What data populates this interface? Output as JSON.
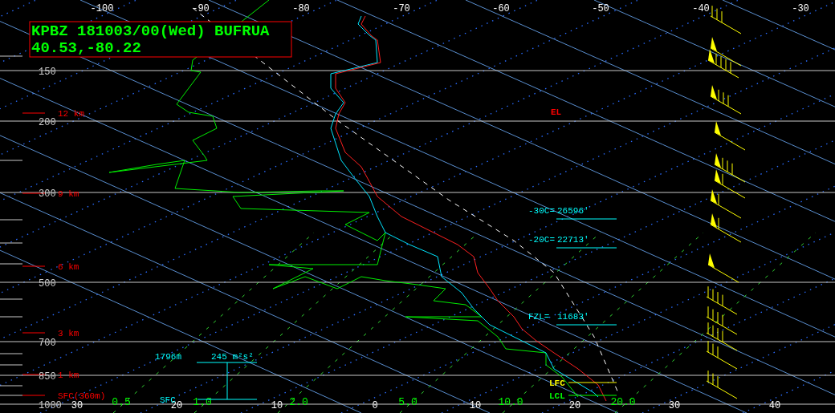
{
  "title_box": {
    "station_line": "KPBZ 181003/00(Wed) BUFRUA",
    "coordinates": "40.53,-80.22"
  },
  "top_temperature_labels": [
    "-100",
    "-90",
    "-80",
    "-70",
    "-60",
    "-50",
    "-40",
    "-30"
  ],
  "bottom_temperature_labels": [
    "30",
    "20",
    "10",
    "0",
    "10",
    "20",
    "30",
    "40"
  ],
  "pressure_labels": [
    "150",
    "200",
    "300",
    "500",
    "700",
    "850",
    "1000"
  ],
  "height_labels": [
    "12 km",
    "9 km",
    "6 km",
    "3 km",
    "1 km",
    "SFC(360m)"
  ],
  "mixing_ratio_labels": [
    "0.5",
    "1.0",
    "2.0",
    "5.0",
    "10.0",
    "20.0"
  ],
  "helicity": {
    "top_height": "1796m",
    "value": "245 m²s²",
    "base": "SFC"
  },
  "temperature_levels": [
    {
      "label": "-30C=",
      "height": "26596'"
    },
    {
      "label": "-20C=",
      "height": "22713'"
    },
    {
      "label": "FZL=",
      "height": "11683'"
    }
  ],
  "parcel_levels": [
    {
      "label": "EL",
      "color": "#ff0000"
    },
    {
      "label": "LFC",
      "color": "#ffff00"
    },
    {
      "label": "LCL",
      "color": "#00ff00"
    }
  ]
}
